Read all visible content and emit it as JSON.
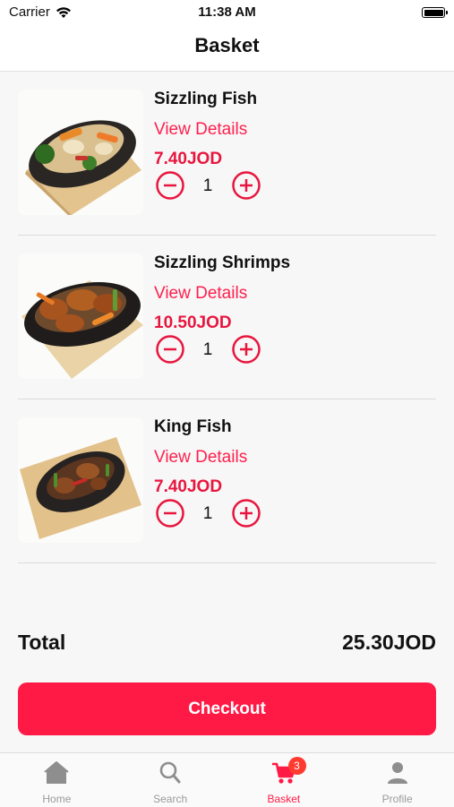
{
  "status_bar": {
    "carrier": "Carrier",
    "time": "11:38 AM"
  },
  "nav": {
    "title": "Basket"
  },
  "items": [
    {
      "name": "Sizzling Fish",
      "details_label": "View Details",
      "price": "7.40JOD",
      "quantity": "1"
    },
    {
      "name": "Sizzling Shrimps",
      "details_label": "View Details",
      "price": "10.50JOD",
      "quantity": "1"
    },
    {
      "name": "King Fish",
      "details_label": "View Details",
      "price": "7.40JOD",
      "quantity": "1"
    }
  ],
  "summary": {
    "total_label": "Total",
    "total_value": "25.30JOD"
  },
  "checkout_label": "Checkout",
  "tabs": [
    {
      "label": "Home",
      "icon": "home-icon"
    },
    {
      "label": "Search",
      "icon": "search-icon"
    },
    {
      "label": "Basket",
      "icon": "cart-icon",
      "badge": "3"
    },
    {
      "label": "Profile",
      "icon": "person-icon"
    }
  ],
  "colors": {
    "accent": "#ff1a45",
    "badge": "#ff3b30"
  }
}
